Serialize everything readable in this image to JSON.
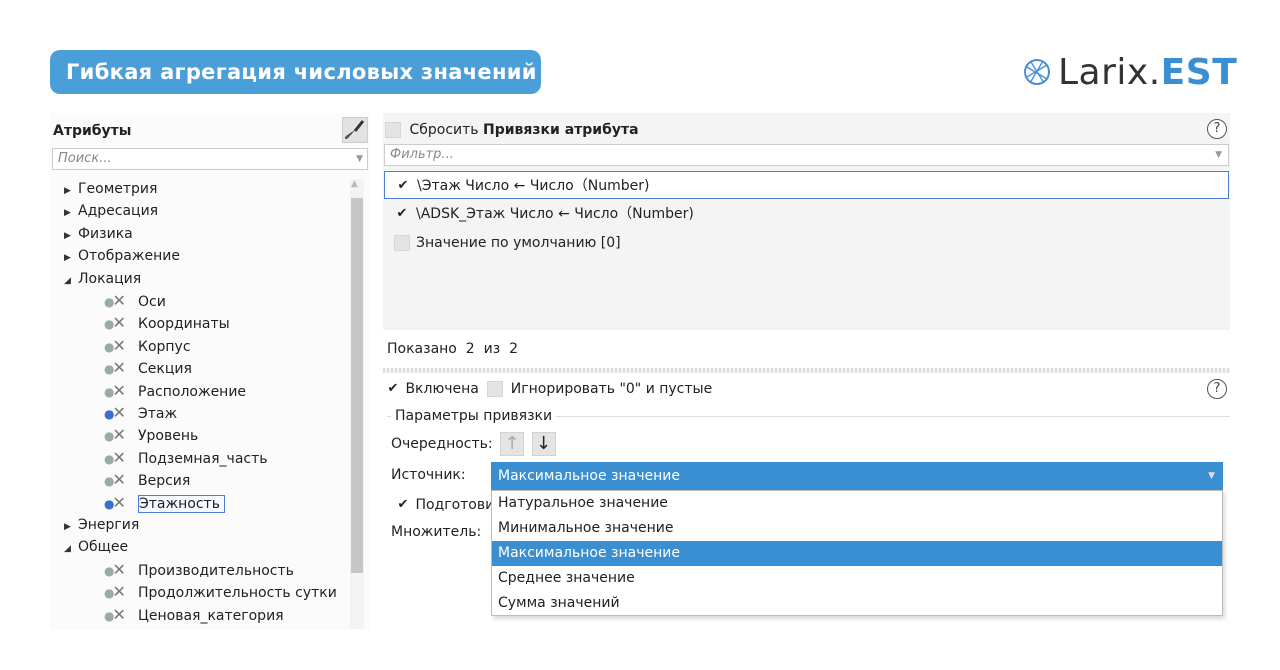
{
  "header": {
    "title": "Гибкая агрегация числовых значений",
    "logo_main": "Larix.",
    "logo_accent": "EST"
  },
  "colors": {
    "accent": "#3a8fd2",
    "title_bg": "#4a9fd8",
    "selection_border": "#4a7fd4"
  },
  "attributes": {
    "title": "Атрибуты",
    "search_placeholder": "Поиск...",
    "tree": [
      {
        "label": "Геометрия",
        "type": "group",
        "expanded": false
      },
      {
        "label": "Адресация",
        "type": "group",
        "expanded": false
      },
      {
        "label": "Физика",
        "type": "group",
        "expanded": false
      },
      {
        "label": "Отображение",
        "type": "group",
        "expanded": false
      },
      {
        "label": "Локация",
        "type": "group",
        "expanded": true
      },
      {
        "label": "Оси",
        "type": "leaf"
      },
      {
        "label": "Координаты",
        "type": "leaf"
      },
      {
        "label": "Корпус",
        "type": "leaf"
      },
      {
        "label": "Секция",
        "type": "leaf"
      },
      {
        "label": "Расположение",
        "type": "leaf"
      },
      {
        "label": "Этаж",
        "type": "leaf",
        "active": true
      },
      {
        "label": "Уровень",
        "type": "leaf"
      },
      {
        "label": "Подземная_часть",
        "type": "leaf"
      },
      {
        "label": "Версия",
        "type": "leaf"
      },
      {
        "label": "Этажность",
        "type": "leaf",
        "active": true,
        "selected": true
      },
      {
        "label": "Энергия",
        "type": "group",
        "expanded": false
      },
      {
        "label": "Общее",
        "type": "group",
        "expanded": true
      },
      {
        "label": "Производительность",
        "type": "leaf"
      },
      {
        "label": "Продолжительность сутки",
        "type": "leaf"
      },
      {
        "label": "Ценовая_категория",
        "type": "leaf"
      }
    ]
  },
  "bindings": {
    "reset_label": "Сбросить",
    "reset_bold": "Привязки атрибута",
    "filter_placeholder": "Фильтр...",
    "rows": [
      {
        "label": "\\Этаж Число ← Число（Number)",
        "checked": true,
        "selected": true
      },
      {
        "label": "\\ADSK_Этаж Число ← Число（Number)",
        "checked": true,
        "selected": false
      },
      {
        "label": "Значение по умолчанию [0]",
        "checked": false,
        "selected": false
      }
    ],
    "shown_label": "Показано",
    "shown_count": "2",
    "shown_of": "из",
    "shown_total": "2"
  },
  "settings": {
    "enabled_label": "Включена",
    "ignore_label": "Игнорировать \"0\" и пустые",
    "group_title": "Параметры привязки",
    "order_label": "Очередность:",
    "source_label": "Источник:",
    "source_value": "Максимальное значение",
    "prep_label": "Подготови",
    "multiplier_label": "Множитель:",
    "options": [
      "Натуральное значение",
      "Минимальное значение",
      "Максимальное значение",
      "Среднее значение",
      "Сумма значений"
    ],
    "selected_option": 2
  }
}
